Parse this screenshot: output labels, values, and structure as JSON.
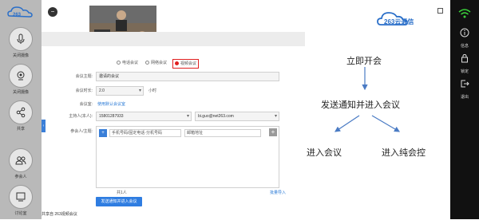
{
  "left_bar": {
    "items": [
      {
        "label": "关闭摄像",
        "icon": "microphone-icon"
      },
      {
        "label": "关闭摄像",
        "icon": "camera-icon"
      },
      {
        "label": "共享",
        "icon": "share-icon"
      },
      {
        "label": "参会人",
        "icon": "participants-icon"
      },
      {
        "label": "讨论室",
        "icon": "chat-icon"
      }
    ]
  },
  "footer_text": "共享自 263视频会议",
  "right_bar": {
    "items": [
      {
        "label": "信息",
        "icon": "info-icon"
      },
      {
        "label": "锁定",
        "icon": "lock-icon"
      },
      {
        "label": "退出",
        "icon": "exit-icon"
      }
    ]
  },
  "topbar": {
    "logo_text": "263云通信"
  },
  "form": {
    "meeting_types": [
      {
        "label": "电话会议",
        "selected": false
      },
      {
        "label": "网络会议",
        "selected": false
      },
      {
        "label": "视频会议",
        "selected": true
      }
    ],
    "fields": [
      {
        "label": "会议主题:",
        "value": "邀请的会议"
      },
      {
        "label": "会议时长:",
        "value": "2.0",
        "suffix": "小时"
      },
      {
        "label": "会议室:",
        "value": "使用默认会议室"
      },
      {
        "label": "主持人(本人):",
        "value": "15801287933",
        "value2": "bi.guo@net263.com"
      },
      {
        "label": "参会人/主题:",
        "value": ""
      }
    ],
    "participant_inputs": [
      "手机号码/固定电话·分机号码",
      "邮箱地址"
    ],
    "count_text": "共1人",
    "import_text": "批量导入",
    "submit_label": "发送通知并进入会议"
  },
  "diagram": {
    "top": "立即开会",
    "middle": "发送通知并进入会议",
    "left": "进入会议",
    "right": "进入纯会控"
  }
}
